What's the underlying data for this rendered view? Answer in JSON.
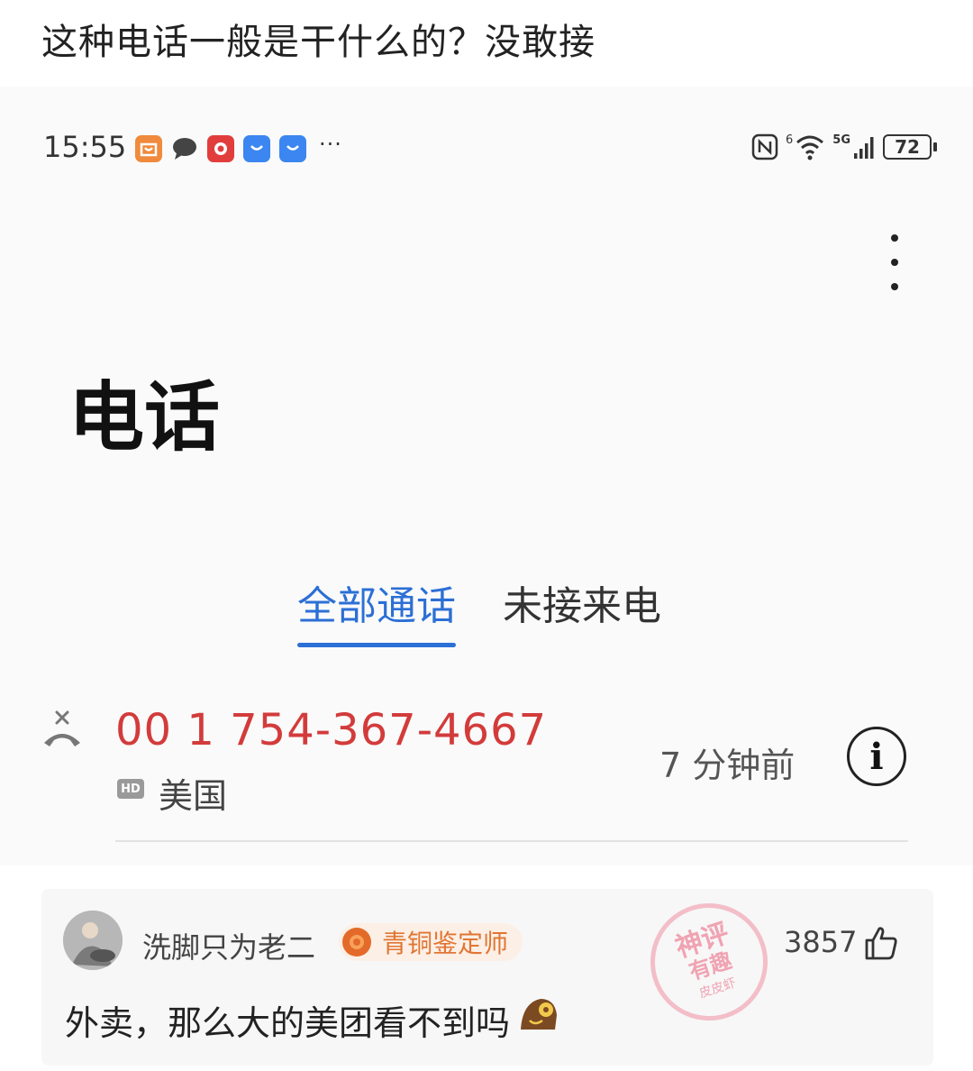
{
  "post": {
    "title": "这种电话一般是干什么的？没敢接"
  },
  "status_bar": {
    "time": "15:55",
    "more": "···",
    "network_labels": [
      "6",
      "5G"
    ],
    "battery": "72"
  },
  "phone_app": {
    "title": "电话",
    "tabs": [
      {
        "label": "全部通话",
        "active": true
      },
      {
        "label": "未接来电",
        "active": false
      }
    ],
    "calls": [
      {
        "number": "00 1 754-367-4667",
        "hd_badge": "HD",
        "location": "美国",
        "time_ago": "7 分钟前",
        "info_glyph": "i",
        "status_color": "#d33b3b"
      }
    ],
    "accent_color": "#2c6fd6"
  },
  "comment": {
    "username": "洗脚只为老二",
    "badge": "青铜鉴定师",
    "stamp": {
      "line1": "神评",
      "line2": "有趣",
      "line3": "皮皮虾"
    },
    "likes": "3857",
    "text": "外卖，那么大的美团看不到吗"
  }
}
